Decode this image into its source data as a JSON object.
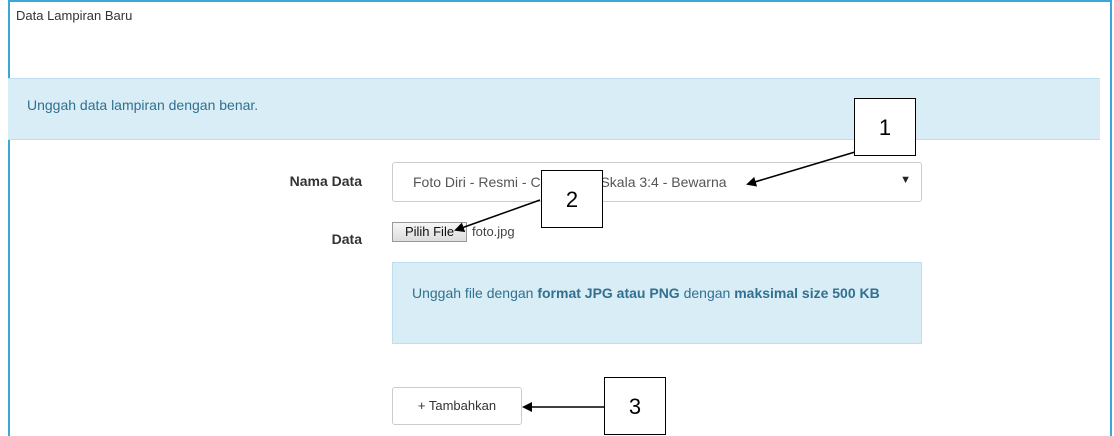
{
  "panel": {
    "heading": "Data Lampiran Baru"
  },
  "alert_top": {
    "text": "Unggah data lampiran dengan benar."
  },
  "form": {
    "nama_data_label": "Nama Data",
    "nama_data_value": "Foto Diri - Resmi - Close Up - Skala 3:4 - Bewarna",
    "data_label": "Data",
    "file_button_label": "Pilih File",
    "file_name": "foto.jpg"
  },
  "help": {
    "text_1": "Unggah file dengan ",
    "bold_1": "format JPG atau PNG",
    "text_2": " dengan ",
    "bold_2": "maksimal size 500 KB"
  },
  "add_button": {
    "label": "+ Tambahkan"
  },
  "callouts": [
    {
      "number": "1"
    },
    {
      "number": "2"
    },
    {
      "number": "3"
    }
  ],
  "colors": {
    "panel_border": "#3ba7d9",
    "alert_bg": "#d9edf7",
    "alert_text": "#31708f"
  }
}
